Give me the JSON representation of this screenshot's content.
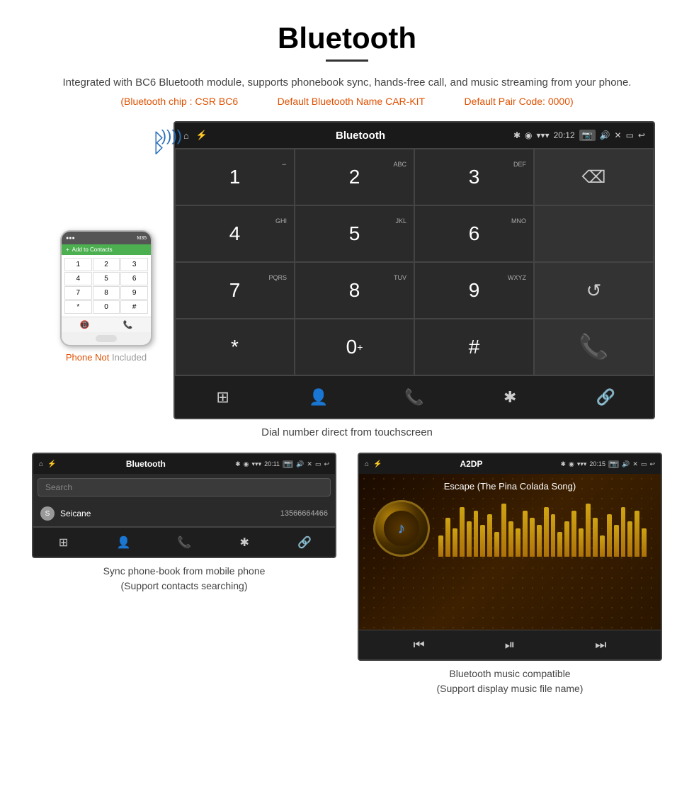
{
  "header": {
    "title": "Bluetooth",
    "subtitle": "Integrated with BC6 Bluetooth module, supports phonebook sync, hands-free call, and music streaming from your phone.",
    "specs": {
      "chip": "(Bluetooth chip : CSR BC6",
      "name": "Default Bluetooth Name CAR-KIT",
      "code": "Default Pair Code: 0000)"
    }
  },
  "dialer_screen": {
    "status_bar": {
      "left": "⌂",
      "center": "Bluetooth",
      "usb": "⚡",
      "bluetooth": "✱",
      "location": "◉",
      "signal": "▾",
      "time": "20:12",
      "camera": "📷",
      "volume": "🔊",
      "close": "✕",
      "rect": "▭",
      "back": "↩"
    },
    "keys": [
      {
        "num": "1",
        "sub": "∽"
      },
      {
        "num": "2",
        "sub": "ABC"
      },
      {
        "num": "3",
        "sub": "DEF"
      },
      {
        "num": "",
        "sub": "",
        "action": "backspace"
      },
      {
        "num": "4",
        "sub": "GHI"
      },
      {
        "num": "5",
        "sub": "JKL"
      },
      {
        "num": "6",
        "sub": "MNO"
      },
      {
        "num": "",
        "sub": "",
        "action": "empty"
      },
      {
        "num": "7",
        "sub": "PQRS"
      },
      {
        "num": "8",
        "sub": "TUV"
      },
      {
        "num": "9",
        "sub": "WXYZ"
      },
      {
        "num": "",
        "sub": "",
        "action": "reload"
      },
      {
        "num": "*",
        "sub": ""
      },
      {
        "num": "0",
        "sub": "+"
      },
      {
        "num": "#",
        "sub": ""
      },
      {
        "num": "",
        "sub": "",
        "action": "call"
      }
    ],
    "nav_bar": {
      "items": [
        "⊞",
        "👤",
        "📞",
        "✱",
        "🔗"
      ]
    }
  },
  "dial_caption": "Dial number direct from touchscreen",
  "phonebook_screen": {
    "status_bar": {
      "left": "⌂",
      "center": "Bluetooth",
      "usb": "⚡",
      "bluetooth": "✱",
      "location": "◉",
      "signal": "▾",
      "time": "20:11",
      "camera": "📷",
      "volume": "🔊",
      "close": "✕",
      "rect": "▭",
      "back": "↩"
    },
    "search_placeholder": "Search",
    "contacts": [
      {
        "letter": "S",
        "name": "Seicane",
        "phone": "13566664466"
      }
    ],
    "nav_bar": {
      "items": [
        "⊞",
        "👤",
        "📞",
        "✱",
        "🔗"
      ]
    }
  },
  "phonebook_caption": {
    "line1": "Sync phone-book from mobile phone",
    "line2": "(Support contacts searching)"
  },
  "music_screen": {
    "status_bar": {
      "left": "⌂",
      "center": "A2DP",
      "usb": "⚡",
      "bluetooth": "✱",
      "location": "◉",
      "signal": "▾",
      "time": "20:15",
      "camera": "📷",
      "volume": "🔊",
      "close": "✕",
      "rect": "▭",
      "back": "↩"
    },
    "song_title": "Escape (The Pina Colada Song)",
    "eq_bars": [
      30,
      55,
      40,
      70,
      50,
      65,
      45,
      60,
      35,
      75,
      50,
      40,
      65,
      55,
      45,
      70,
      60,
      35,
      50,
      65,
      40,
      75,
      55,
      30,
      60,
      45,
      70,
      50,
      65,
      40
    ],
    "controls": [
      "⏮",
      "⏯",
      "⏭"
    ]
  },
  "music_caption": {
    "line1": "Bluetooth music compatible",
    "line2": "(Support display music file name)"
  },
  "phone_mockup": {
    "not_included_orange": "Phone Not",
    "not_included_gray": "Included"
  }
}
